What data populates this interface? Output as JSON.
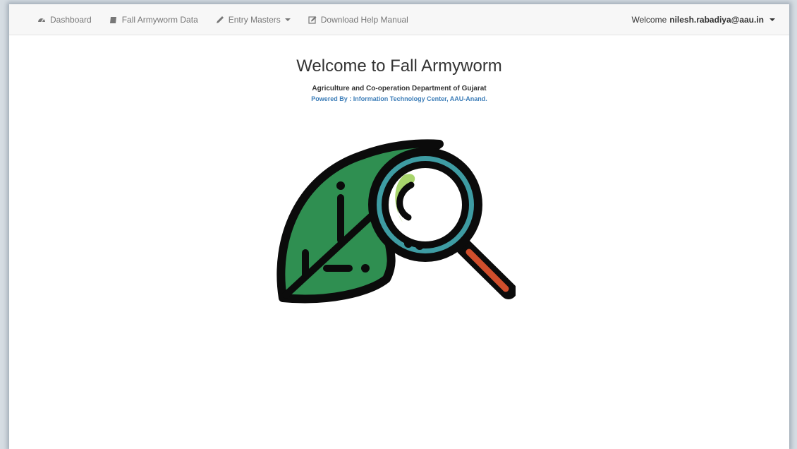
{
  "navbar": {
    "items": [
      {
        "label": "Dashboard",
        "icon": "dashboard-icon"
      },
      {
        "label": "Fall Armyworm Data",
        "icon": "book-icon"
      },
      {
        "label": "Entry Masters",
        "icon": "pencil-icon",
        "dropdown": true
      },
      {
        "label": "Download Help Manual",
        "icon": "edit-icon"
      }
    ],
    "welcome_prefix": "Welcome",
    "user": "nilesh.rabadiya@aau.in"
  },
  "main": {
    "title": "Welcome to Fall Armyworm",
    "subtitle": "Agriculture and Co-operation Department of Gujarat",
    "powered_by": "Powered By : Information Technology Center, AAU-Anand."
  },
  "colors": {
    "leaf": "#2f8f51",
    "leaf_light": "#a8d56c",
    "lens_ring": "#3e9ca3",
    "handle": "#d04e2c",
    "link": "#3c7db8"
  }
}
